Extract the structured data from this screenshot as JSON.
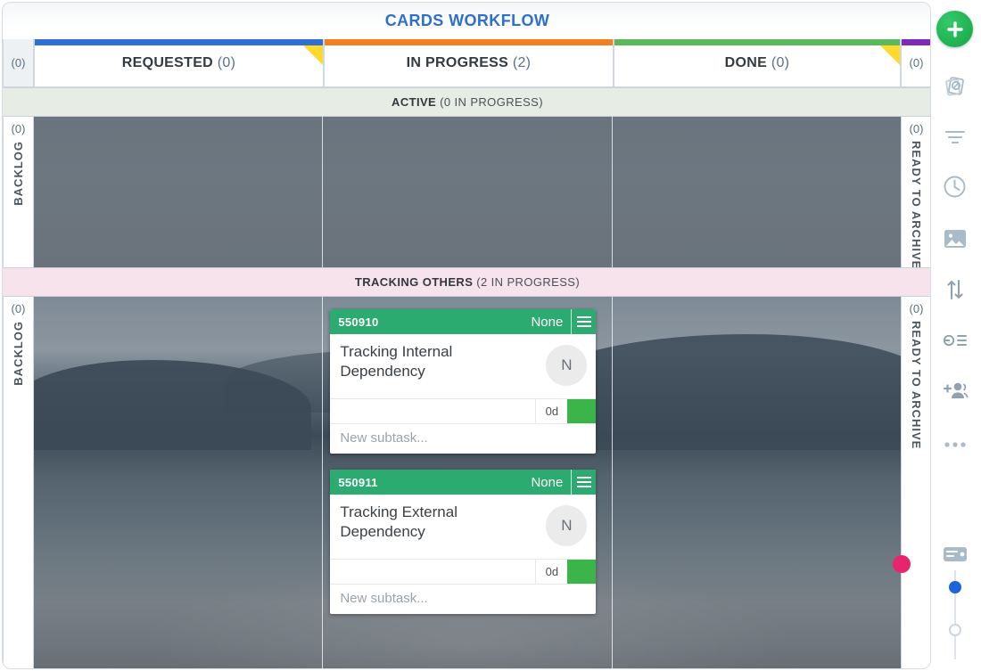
{
  "board": {
    "title": "CARDS WORKFLOW"
  },
  "columns": {
    "left_rail_count": "(0)",
    "right_rail_count": "(0)",
    "items": [
      {
        "label": "REQUESTED",
        "count": "(0)",
        "color": "#2f6fd0",
        "flag": true
      },
      {
        "label": "IN PROGRESS",
        "count": "(2)",
        "color": "#f08020",
        "flag": false
      },
      {
        "label": "DONE",
        "count": "(0)",
        "color": "#5cb85c",
        "flag": true
      }
    ],
    "far_right": {
      "count": "(0)",
      "color": "#8129b8"
    }
  },
  "lanes": [
    {
      "title": "ACTIVE",
      "subtitle": "(0 IN PROGRESS)",
      "background": "#e7ece5",
      "left_rail": {
        "count": "(0)",
        "label": "BACKLOG"
      },
      "right_rail": {
        "count": "(0)",
        "label": "READY TO ARCHIVE"
      },
      "cards": []
    },
    {
      "title": "TRACKING OTHERS",
      "subtitle": "(2 IN PROGRESS)",
      "background": "#f6e3ec",
      "left_rail": {
        "count": "(0)",
        "label": "BACKLOG"
      },
      "right_rail": {
        "count": "(0)",
        "label": "READY TO ARCHIVE"
      },
      "cards": [
        {
          "id": "550910",
          "priority": "None",
          "title": "Tracking Internal Dependency",
          "avatar": "N",
          "days": "0d",
          "flag_color": "#3bb54a",
          "header_color": "#2bab70",
          "subtask_placeholder": "New subtask..."
        },
        {
          "id": "550911",
          "priority": "None",
          "title": "Tracking External Dependency",
          "avatar": "N",
          "days": "0d",
          "flag_color": "#3bb54a",
          "header_color": "#2bab70",
          "subtask_placeholder": "New subtask..."
        }
      ]
    }
  ],
  "sidebar": {
    "add_button": "add-card-button",
    "icons": [
      "cards-stack-icon",
      "filter-icon",
      "clock-icon",
      "image-icon",
      "sort-arrows-icon",
      "user-list-icon",
      "add-people-icon",
      "more-options-icon",
      "card-size-icon"
    ]
  }
}
